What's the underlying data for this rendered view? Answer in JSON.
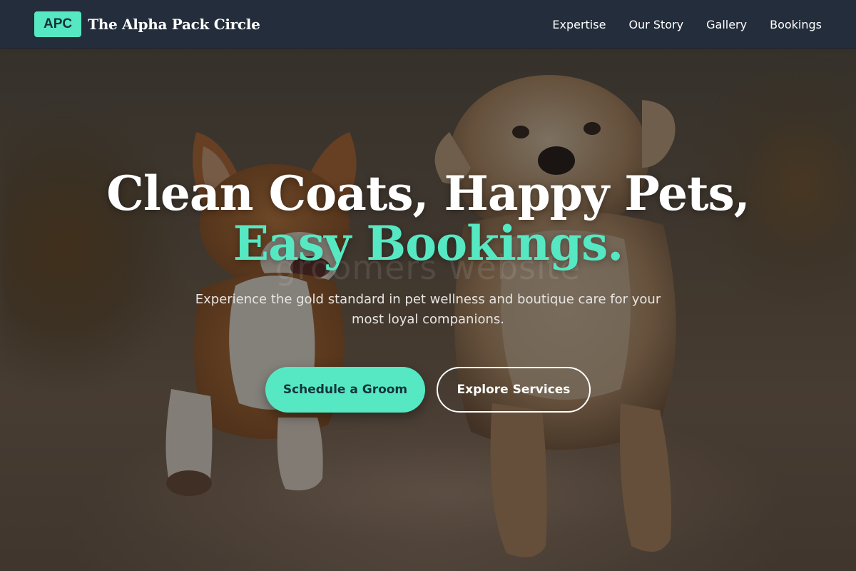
{
  "nav": {
    "logo_badge": "APC",
    "brand_name": "The Alpha Pack Circle",
    "links": [
      "Expertise",
      "Our Story",
      "Gallery",
      "Bookings"
    ]
  },
  "hero": {
    "title_line1": "Clean Coats, Happy Pets,",
    "title_line2": "Easy Bookings.",
    "subtitle": "Experience the gold standard in pet wellness and boutique care for your most loyal companions.",
    "primary_cta": "Schedule a Groom",
    "secondary_cta": "Explore Services",
    "watermark": "groomers website"
  },
  "colors": {
    "accent": "#56e8c2",
    "navbar_bg": "#232d3b",
    "text_light": "#ffffff"
  }
}
